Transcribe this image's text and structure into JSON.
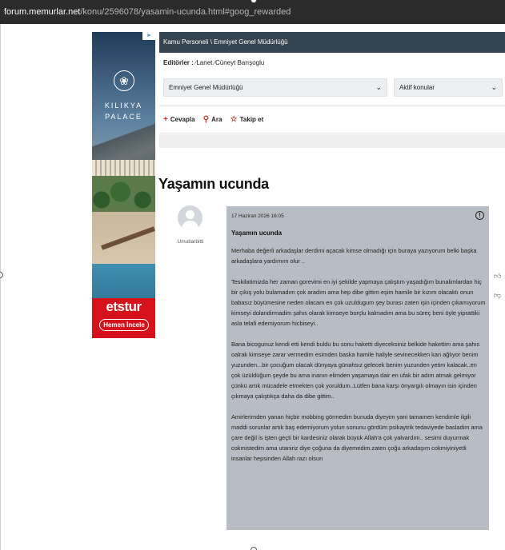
{
  "browser": {
    "url_domain": "forum.memurlar.net",
    "url_path": "/konu/2596078/yasamin-ucunda.html#goog_rewarded"
  },
  "ad": {
    "corner_label": "i▸",
    "logo_glyph": "❀",
    "brand_line1": "KILIKYA",
    "brand_line2": "PALACE",
    "sponsor": "etstur",
    "cta": "Hemen İncele"
  },
  "breadcrumb": {
    "text": "Kamu Personeli \\ Emniyet Genel Müdürlüğü"
  },
  "editors": {
    "label": "Editörler :",
    "names": [
      "Lanet",
      "Cüneyt Barışoglu"
    ]
  },
  "filters": {
    "category": "Emniyet Genel Müdürlüğü",
    "topic_filter": "Aktif konular"
  },
  "actions": {
    "reply": "Cevapla",
    "search": "Ara",
    "follow": "Takip et"
  },
  "topic": {
    "title": "Yaşamın ucunda"
  },
  "post": {
    "author": "Umutlarbitti",
    "date": "17 Haziran 2026 16:05",
    "subject": "Yaşamın ucunda",
    "paragraphs": [
      "Merhaba değerli arkadaşlar derdimi açacak kimse olmadığı için buraya yazıyorum belki başka arkadaşlara yardımım olur ..",
      "Teskilatimizda her zaman gorevimi en iyi şekilde yapmaya çalıştım yaşadığım bunalimlardan hiç bir çıkış yolu bulamadım çok aradım ama hep dibe gittim eşim hamile bir kızım olacaktı onun babasız büyümesine neden olacam en çok uzuldugum şey burası zaten işin içinden çıkamıyorum kimseyi dolandirmadim şahıs olarak kimseye borçlu kalmadım ama bu süreç beni öyle yiprattiki asla telafi edemiyorum hicbiseyi..",
      "Bana bicogunuz kendi etti kendi buldu bu sonu haketti diyeceksiniz belkide hakettim ama şahıs oalrak kimseye zarar vermedim esimden baska hamile haliyle sevinecekken kan ağlıyor benim yuzunden...bir çocuğum olacak dünyaya günahsız gelecek benim yuzunden yetim kalacak..en çok üzüldüğum şeyde bu ama inanın elimden yaşamaya dair en ufak bir adım atmak gelmiyor çünkü artık mücadele etmekten çok yoruldum..Lütfen bana karşı önyargılı olmayın isin içinden çıkmaya çalıştıkça daha da dibe gittim..",
      "Amirlerimden yanan hiçbir mobbing görmedim bunuda diyeyim yani tamamen kendimle ilgili maddi sorunlar artık baş edemiyorum yolun sonunu gördüm psikaytrik tedaviyede basladim ama çare değil is işten geçti bir kardesiniz olarak büyük Allah'a çok yalvardım.. sesimi duyurmak cokmistedim ama utaniriz diye çoğuna da diyemedim.zaten çoğu arkadaşım cokmiyiniyetli insanlar hepsinden Allah razı olsun"
    ]
  },
  "icons": {
    "pen": "pen-icon",
    "plus": "plus-icon",
    "search": "search-icon",
    "star": "star-icon",
    "report": "report-icon",
    "like": "thumbs-up-icon",
    "dislike": "thumbs-down-icon",
    "chevron": "chevron-down-icon"
  },
  "colors": {
    "breadcrumb_bg": "#34434f",
    "post_bg": "#b8bcc4",
    "accent_red": "#c0392b",
    "ad_red": "#d5121c"
  }
}
